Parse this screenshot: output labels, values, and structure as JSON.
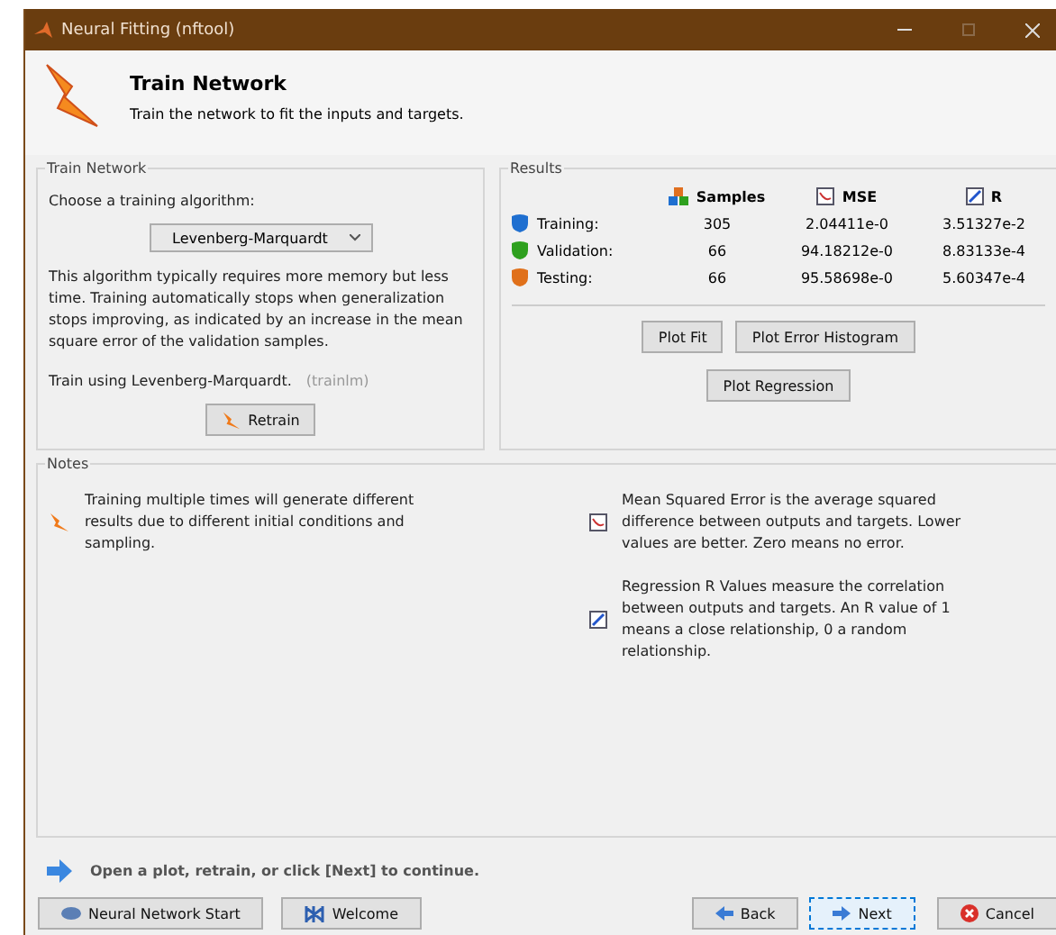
{
  "window": {
    "title": "Neural Fitting (nftool)"
  },
  "header": {
    "title": "Train Network",
    "subtitle": "Train the network to fit the inputs and targets."
  },
  "train_panel": {
    "legend": "Train Network",
    "prompt": "Choose a training algorithm:",
    "algorithm": "Levenberg-Marquardt",
    "description": "This algorithm typically requires more memory but less time. Training automatically stops when generalization stops improving, as indicated by an increase in the mean square error of the validation samples.",
    "train_using": "Train using Levenberg-Marquardt.",
    "function": "(trainlm)",
    "retrain_button": "Retrain"
  },
  "results": {
    "legend": "Results",
    "columns": [
      {
        "label": "Samples",
        "kind": "samples"
      },
      {
        "label": "MSE",
        "kind": "mse"
      },
      {
        "label": "R",
        "kind": "r"
      }
    ],
    "rows": [
      {
        "label": "Training:",
        "color": "#1f6fd0",
        "samples": "305",
        "mse": "2.04411e-0",
        "r": "3.51327e-2"
      },
      {
        "label": "Validation:",
        "color": "#2ea01e",
        "samples": "66",
        "mse": "94.18212e-0",
        "r": "8.83133e-4"
      },
      {
        "label": "Testing:",
        "color": "#e0701a",
        "samples": "66",
        "mse": "95.58698e-0",
        "r": "5.60347e-4"
      }
    ],
    "buttons": [
      "Plot Fit",
      "Plot Error Histogram",
      "Plot Regression"
    ]
  },
  "notes": {
    "legend": "Notes",
    "items": [
      {
        "kind": "retrain",
        "text": "Training multiple times will generate different results due to different initial conditions and sampling."
      },
      {
        "kind": "mse",
        "text": "Mean Squared Error is the average squared difference between outputs and targets. Lower values are better. Zero means no error."
      },
      {
        "kind": "r",
        "text": "Regression R Values measure the correlation between outputs and targets. An R value of 1 means a close relationship, 0 a random relationship."
      }
    ]
  },
  "status": "Open a plot, retrain, or click [Next] to continue.",
  "footer": {
    "left_buttons": [
      {
        "label": "Neural Network Start",
        "kind": "start"
      },
      {
        "label": "Welcome",
        "kind": "welcome"
      }
    ],
    "right_buttons": [
      {
        "label": "Back",
        "kind": "back",
        "focused": false
      },
      {
        "label": "Next",
        "kind": "next",
        "focused": true
      },
      {
        "label": "Cancel",
        "kind": "cancel",
        "focused": false
      }
    ]
  }
}
